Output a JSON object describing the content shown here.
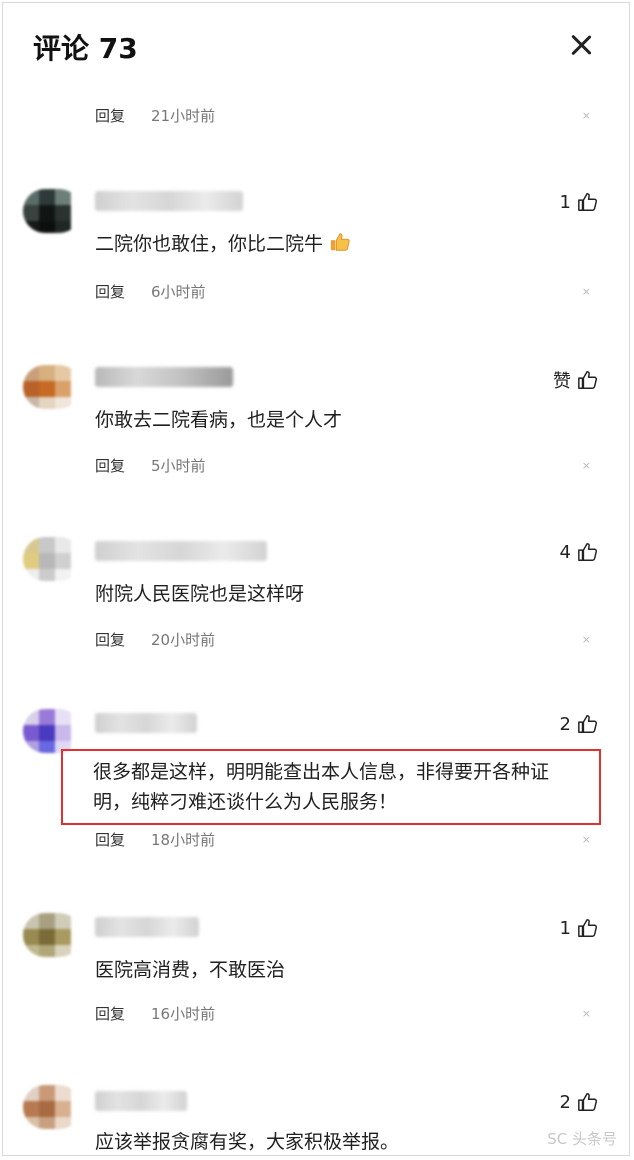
{
  "header": {
    "title": "评论 73"
  },
  "comments": [
    {
      "text": "",
      "reply_label": "回复",
      "time": "21小时前",
      "likes": ""
    },
    {
      "text": "二院你也敢住，你比二院牛",
      "reply_label": "回复",
      "time": "6小时前",
      "likes": "1",
      "emoji": "thumbs-up-emoji"
    },
    {
      "text": "你敢去二院看病，也是个人才",
      "reply_label": "回复",
      "time": "5小时前",
      "likes": "赞"
    },
    {
      "text": "附院人民医院也是这样呀",
      "reply_label": "回复",
      "time": "20小时前",
      "likes": "4"
    },
    {
      "text_lines": [
        "很多都是这样，明明能查出本人信息，非得要开各种证",
        "明，纯粹刁难还谈什么为人民服务！"
      ],
      "reply_label": "回复",
      "time": "18小时前",
      "likes": "2"
    },
    {
      "text": "医院高消费，不敢医治",
      "reply_label": "回复",
      "time": "16小时前",
      "likes": "1"
    },
    {
      "text": "应该举报贪腐有奖，大家积极举报。",
      "likes": "2"
    }
  ],
  "dismiss_glyph": "×",
  "colors": {
    "highlight_border": "#e03030",
    "like_icon": "#222222"
  },
  "watermark": "SC 头条号"
}
